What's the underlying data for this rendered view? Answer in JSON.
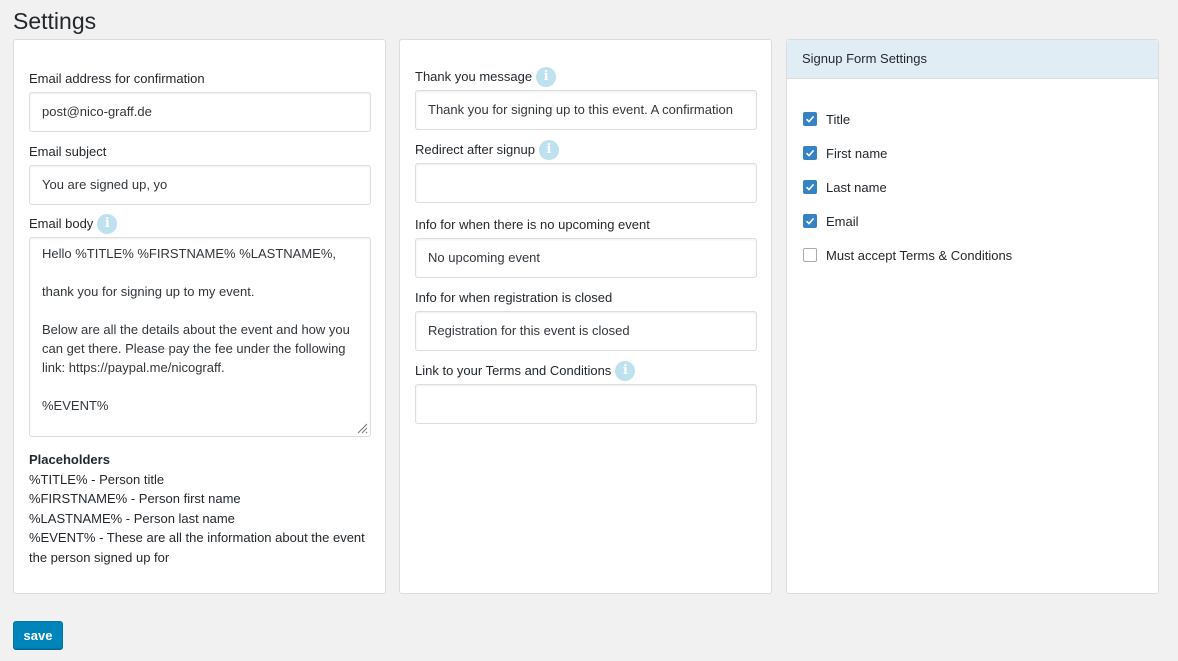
{
  "page": {
    "title": "Settings"
  },
  "email_panel": {
    "confirmation_label": "Email address for confirmation",
    "confirmation_value": "post@nico-graff.de",
    "subject_label": "Email subject",
    "subject_value": "You are signed up, yo",
    "body_label": "Email body",
    "body_lines": [
      "Hello %TITLE% %FIRSTNAME% %LASTNAME%,",
      "thank you for signing up to my event.",
      "Below are all the details about the event and how you can get there. Please pay the fee under the following link: https://paypal.me/nicograff.",
      "%EVENT%"
    ],
    "placeholders_title": "Placeholders",
    "placeholders": [
      "%TITLE% - Person title",
      "%FIRSTNAME% - Person first name",
      "%LASTNAME% - Person last name",
      "%EVENT% - These are all the information about the event the person signed up for"
    ]
  },
  "messages_panel": {
    "thank_you_label": "Thank you message",
    "thank_you_value": "Thank you for signing up to this event. A confirmation",
    "redirect_label": "Redirect after signup",
    "redirect_value": "",
    "no_event_label": "Info for when there is no upcoming event",
    "no_event_value": "No upcoming event",
    "closed_label": "Info for when registration is closed",
    "closed_value": "Registration for this event is closed",
    "terms_label": "Link to your Terms and Conditions",
    "terms_value": ""
  },
  "signup_panel": {
    "title": "Signup Form Settings",
    "options": [
      {
        "label": "Title",
        "checked": true
      },
      {
        "label": "First name",
        "checked": true
      },
      {
        "label": "Last name",
        "checked": true
      },
      {
        "label": "Email",
        "checked": true
      },
      {
        "label": "Must accept Terms & Conditions",
        "checked": false
      }
    ]
  },
  "actions": {
    "save_label": "save"
  },
  "icons": {
    "info": "info-icon",
    "check": "check-icon",
    "resize": "resize-grip-icon"
  },
  "colors": {
    "accent": "#0085ba",
    "checkbox": "#3582c4",
    "info_badge": "#bde1ef",
    "panel_header": "#e1edf5"
  }
}
